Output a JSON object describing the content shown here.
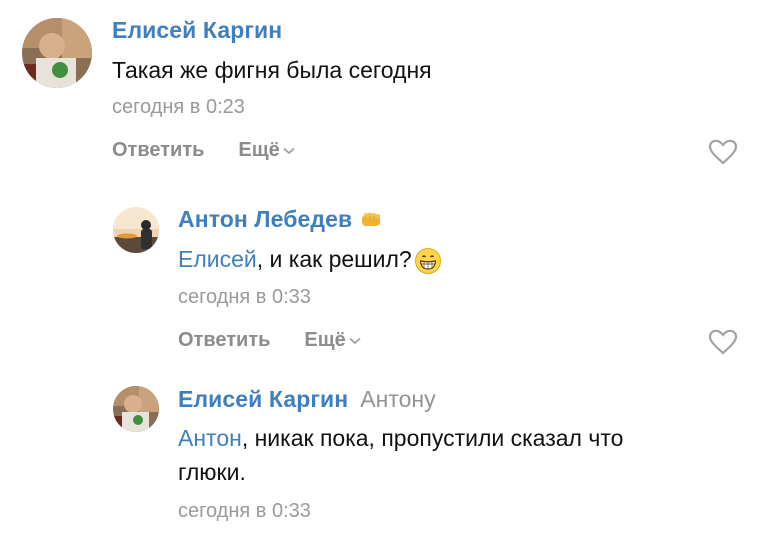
{
  "comments": [
    {
      "author": "Елисей Каргин",
      "text": "Такая же фигня была сегодня",
      "time": "сегодня в 0:23",
      "reply_label": "Ответить",
      "more_label": "Ещё"
    },
    {
      "author": "Антон Лебедев",
      "mention": "Елисей",
      "text_rest": ", и как решил?",
      "time": "сегодня в 0:33",
      "reply_label": "Ответить",
      "more_label": "Ещё",
      "badge_icon": "fist-icon",
      "emoji_icon": "grinning-face-icon"
    },
    {
      "author": "Елисей Каргин",
      "reply_to": "Антону",
      "mention": "Антон",
      "text_rest": ", никак пока, пропустили сказал что",
      "text_line2": "глюки.",
      "time": "сегодня в 0:33"
    }
  ],
  "colors": {
    "author_link": "#3f7fbf",
    "meta_gray": "#9a9a9a",
    "heart_gray": "#a3a3a3"
  }
}
